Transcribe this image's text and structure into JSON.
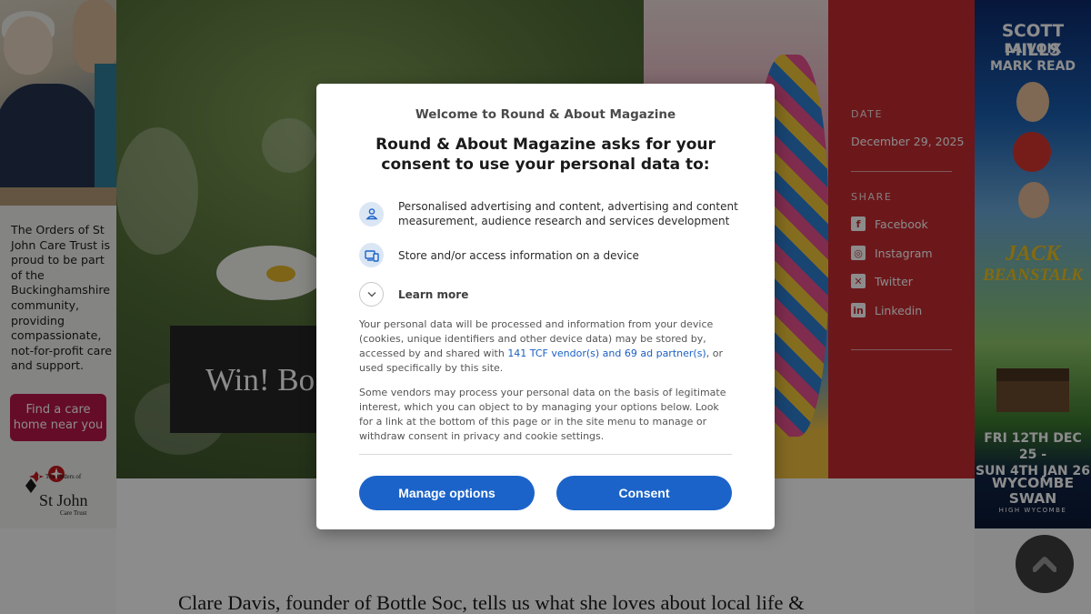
{
  "left_ad": {
    "text": "The Orders of St John Care Trust is proud to be part of the Buckinghamshire community, providing compassionate, not-for-profit care and support.",
    "button": "Find a care home near you",
    "logo_line1": "The Orders of",
    "logo_line2": "St John",
    "logo_line3": "Care Trust"
  },
  "hero": {
    "title_fragment": "Win! Bo"
  },
  "side_panel": {
    "date_label": "DATE",
    "date_value": "December 29, 2025",
    "share_label": "SHARE",
    "share_items": [
      {
        "label": "Facebook",
        "icon": "facebook-icon"
      },
      {
        "label": "Instagram",
        "icon": "instagram-icon"
      },
      {
        "label": "Twitter",
        "icon": "twitter-x-icon"
      },
      {
        "label": "Linkedin",
        "icon": "linkedin-icon"
      }
    ]
  },
  "right_ad": {
    "line1": "SCOTT MILLS",
    "line2": "LA VOIX",
    "line3": "MARK READ",
    "show_line1": "JACK",
    "show_line2": "BEANSTALK",
    "dates_line1": "FRI 12TH DEC 25 -",
    "dates_line2": "SUN 4TH JAN 26",
    "venue_line1": "WYCOMBE",
    "venue_line2": "SWAN",
    "venue_line3": "HIGH WYCOMBE"
  },
  "article": {
    "intro": "Clare Davis, founder of Bottle Soc, tells us what she loves about local life &"
  },
  "consent": {
    "welcome": "Welcome to Round & About Magazine",
    "headline": "Round & About Magazine asks for your consent to use your personal data to:",
    "purposes": [
      {
        "icon": "person-icon",
        "text": "Personalised advertising and content, advertising and content measurement, audience research and services development"
      },
      {
        "icon": "device-icon",
        "text": "Store and/or access information on a device"
      }
    ],
    "learn_more": "Learn more",
    "para1_before": "Your personal data will be processed and information from your device (cookies, unique identifiers and other device data) may be stored by, accessed by and shared with ",
    "para1_link": "141 TCF vendor(s) and 69 ad partner(s)",
    "para1_after": ", or used specifically by this site.",
    "para2": "Some vendors may process your personal data on the basis of legitimate interest, which you can object to by managing your options below. Look for a link at the bottom of this page or in the site menu to manage or withdraw consent in privacy and cookie settings.",
    "manage_button": "Manage options",
    "consent_button": "Consent"
  },
  "colors": {
    "accent": "#1b63c9",
    "side_panel": "#c52d32",
    "ad_button": "#b8174c"
  }
}
